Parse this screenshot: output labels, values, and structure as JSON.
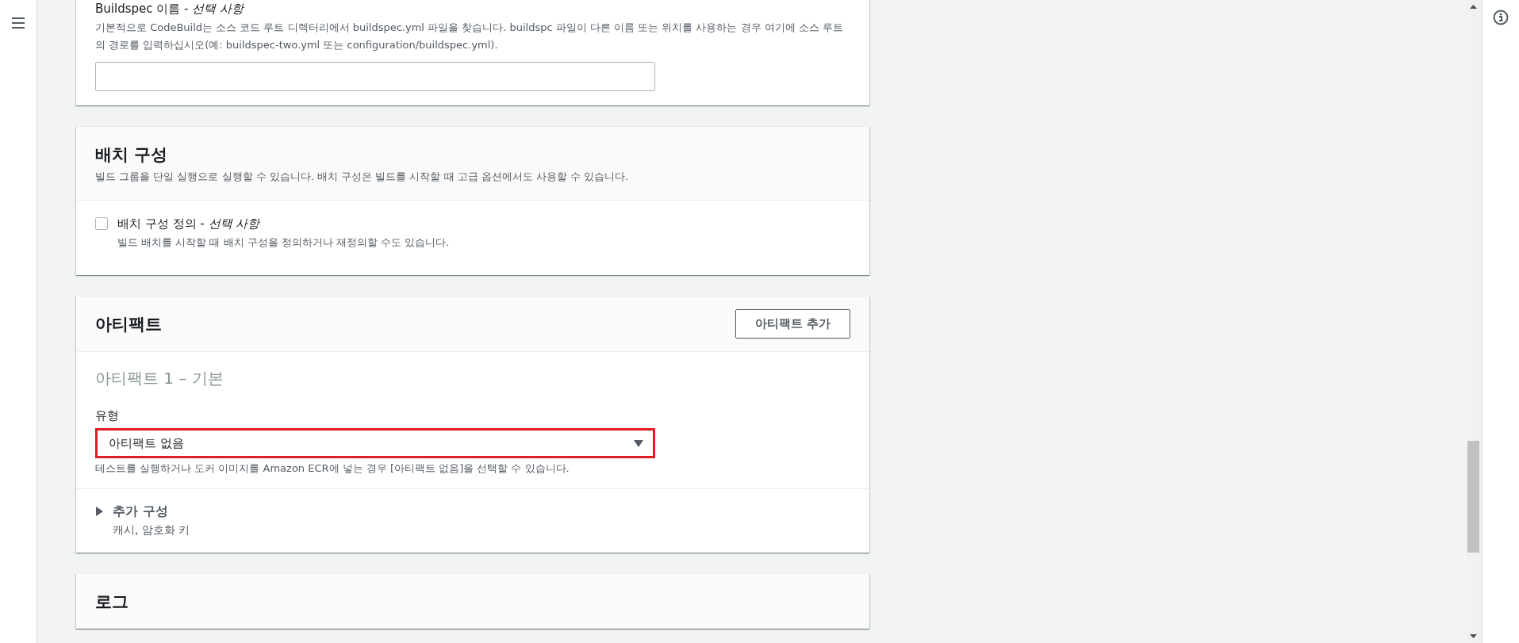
{
  "buildspec_section": {
    "label": "Buildspec 이름 - ",
    "label_optional": "선택 사항",
    "description": "기본적으로 CodeBuild는 소스 코드 루트 디렉터리에서 buildspec.yml 파일을 찾습니다. buildspc 파일이 다른 이름 또는 위치를 사용하는 경우 여기에 소스 루트의 경로를 입력하십시오(예: buildspec-two.yml 또는 configuration/buildspec.yml)."
  },
  "batch_section": {
    "title": "배치 구성",
    "description": "빌드 그룹을 단일 실행으로 실행할 수 있습니다. 배치 구성은 빌드를 시작할 때 고급 옵션에서도 사용할 수 있습니다.",
    "checkbox": {
      "label": "배치 구성 정의 - ",
      "label_optional": "선택 사항",
      "description": "빌드 배치를 시작할 때 배치 구성을 정의하거나 재정의할 수도 있습니다.",
      "checked": false
    }
  },
  "artifacts_section": {
    "title": "아티팩트",
    "add_button": "아티팩트 추가",
    "subtitle": "아티팩트 1 – 기본",
    "type_label": "유형",
    "type_value": "아티팩트 없음",
    "highlighted": true,
    "type_help": "테스트를 실행하거나 도커 이미지를 Amazon ECR에 넣는 경우 [아티팩트 없음]을 선택할 수 있습니다.",
    "additional": {
      "title": "추가 구성",
      "description": "캐시, 암호화 키",
      "expanded": false
    }
  },
  "logs_section": {
    "title": "로그"
  }
}
